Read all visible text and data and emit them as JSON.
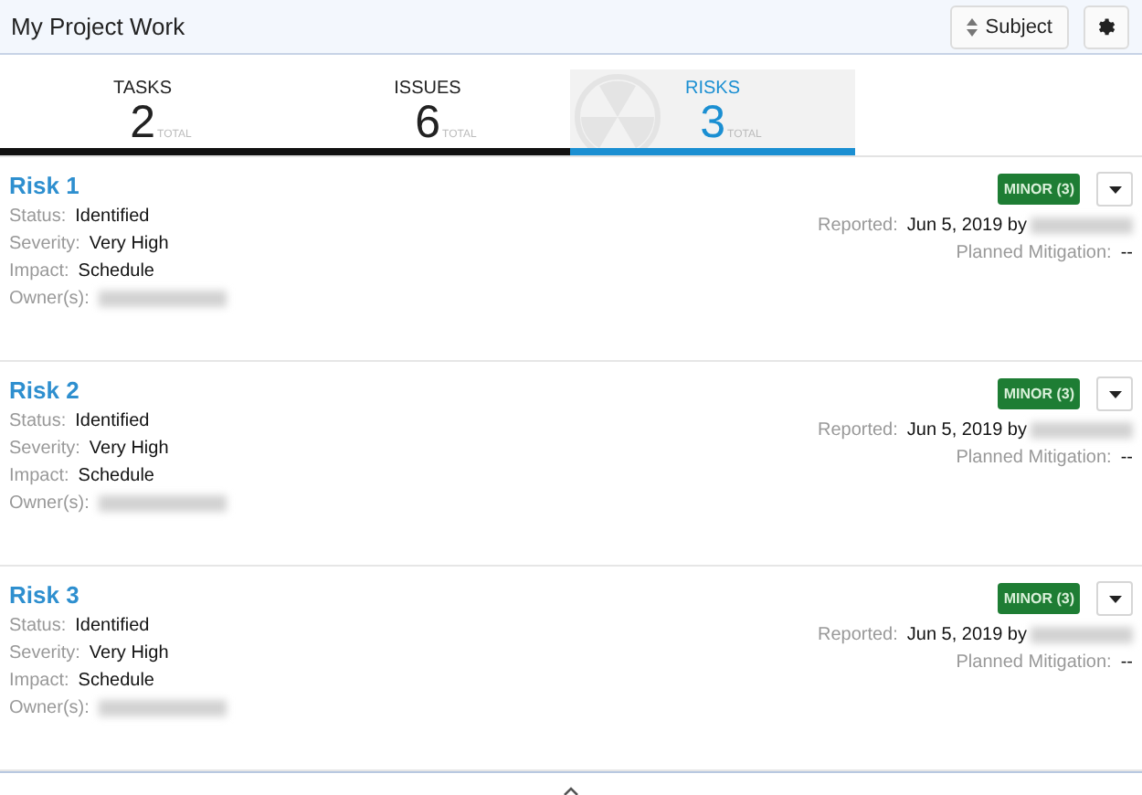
{
  "header": {
    "title": "My Project Work",
    "sort_button": "Subject"
  },
  "tabs": [
    {
      "label": "TASKS",
      "count": "2",
      "unit": "TOTAL",
      "selected": false
    },
    {
      "label": "ISSUES",
      "count": "6",
      "unit": "TOTAL",
      "selected": false
    },
    {
      "label": "RISKS",
      "count": "3",
      "unit": "TOTAL",
      "selected": true
    }
  ],
  "risks": [
    {
      "title": "Risk 1",
      "fields": [
        {
          "label": "Status:",
          "value": "Identified"
        },
        {
          "label": "Severity:",
          "value": "Very High"
        },
        {
          "label": "Impact:",
          "value": "Schedule"
        },
        {
          "label": "Owner(s):",
          "redacted": true
        }
      ],
      "badge": "MINOR (3)",
      "reported_label": "Reported:",
      "reported_value": "Jun 5, 2019 by",
      "mitigation_label": "Planned Mitigation:",
      "mitigation_value": "--"
    },
    {
      "title": "Risk 2",
      "fields": [
        {
          "label": "Status:",
          "value": "Identified"
        },
        {
          "label": "Severity:",
          "value": "Very High"
        },
        {
          "label": "Impact:",
          "value": "Schedule"
        },
        {
          "label": "Owner(s):",
          "redacted": true
        }
      ],
      "badge": "MINOR (3)",
      "reported_label": "Reported:",
      "reported_value": "Jun 5, 2019 by",
      "mitigation_label": "Planned Mitigation:",
      "mitigation_value": "--"
    },
    {
      "title": "Risk 3",
      "fields": [
        {
          "label": "Status:",
          "value": "Identified"
        },
        {
          "label": "Severity:",
          "value": "Very High"
        },
        {
          "label": "Impact:",
          "value": "Schedule"
        },
        {
          "label": "Owner(s):",
          "redacted": true
        }
      ],
      "badge": "MINOR (3)",
      "reported_label": "Reported:",
      "reported_value": "Jun 5, 2019 by",
      "mitigation_label": "Planned Mitigation:",
      "mitigation_value": "--"
    }
  ]
}
